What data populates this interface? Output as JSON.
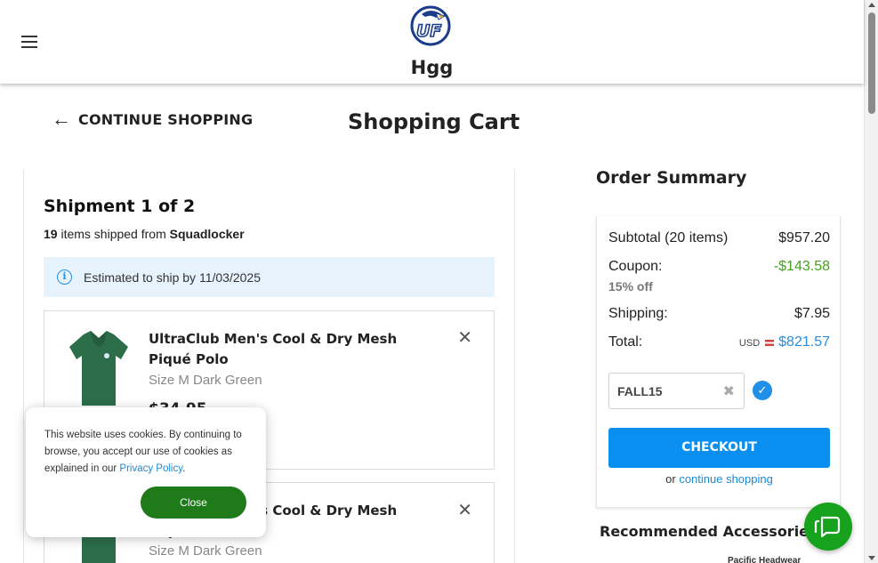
{
  "header": {
    "store_name": "Hgg",
    "logo_icon": "uf-eagle-logo"
  },
  "nav": {
    "continue_label": "CONTINUE SHOPPING",
    "page_title": "Shopping Cart"
  },
  "shipment": {
    "title": "Shipment 1 of 2",
    "count": "19",
    "count_text": " items shipped from ",
    "vendor": "Squadlocker",
    "eta": "Estimated to ship by 11/03/2025",
    "items": [
      {
        "name": "UltraClub Men's Cool & Dry Mesh Piqué Polo",
        "variant": "Size M Dark Green",
        "price": "$34.95"
      },
      {
        "name": "UltraClub Men's Cool & Dry Mesh Piqué Polo",
        "variant": "Size M Dark Green",
        "price": ""
      }
    ]
  },
  "summary": {
    "title": "Order Summary",
    "subtotal_label": "Subtotal (20 items)",
    "subtotal_value": "$957.20",
    "coupon_label": "Coupon:",
    "coupon_value": "-$143.58",
    "coupon_pct": "15% off",
    "shipping_label": "Shipping:",
    "shipping_value": "$7.95",
    "total_label": "Total:",
    "currency": "USD",
    "total_value": "$821.57",
    "coupon_code": "FALL15",
    "checkout_label": "CHECKOUT",
    "or_text": "or ",
    "continue_link": "continue shopping",
    "recommended_title": "Recommended Accessories",
    "recommended_sub": "Pacific Headwear"
  },
  "cookie": {
    "text": "This website uses cookies. By continuing to browse, you accept our use of cookies as explained in our ",
    "link": "Privacy Policy",
    "link_suffix": ".",
    "close_label": "Close"
  },
  "colors": {
    "accent": "#0a8ff0",
    "coupon_green": "#45a31a",
    "cookie_button": "#1f7a1a",
    "chat_button": "#17a21d",
    "banner_bg": "#e6f2fc"
  }
}
